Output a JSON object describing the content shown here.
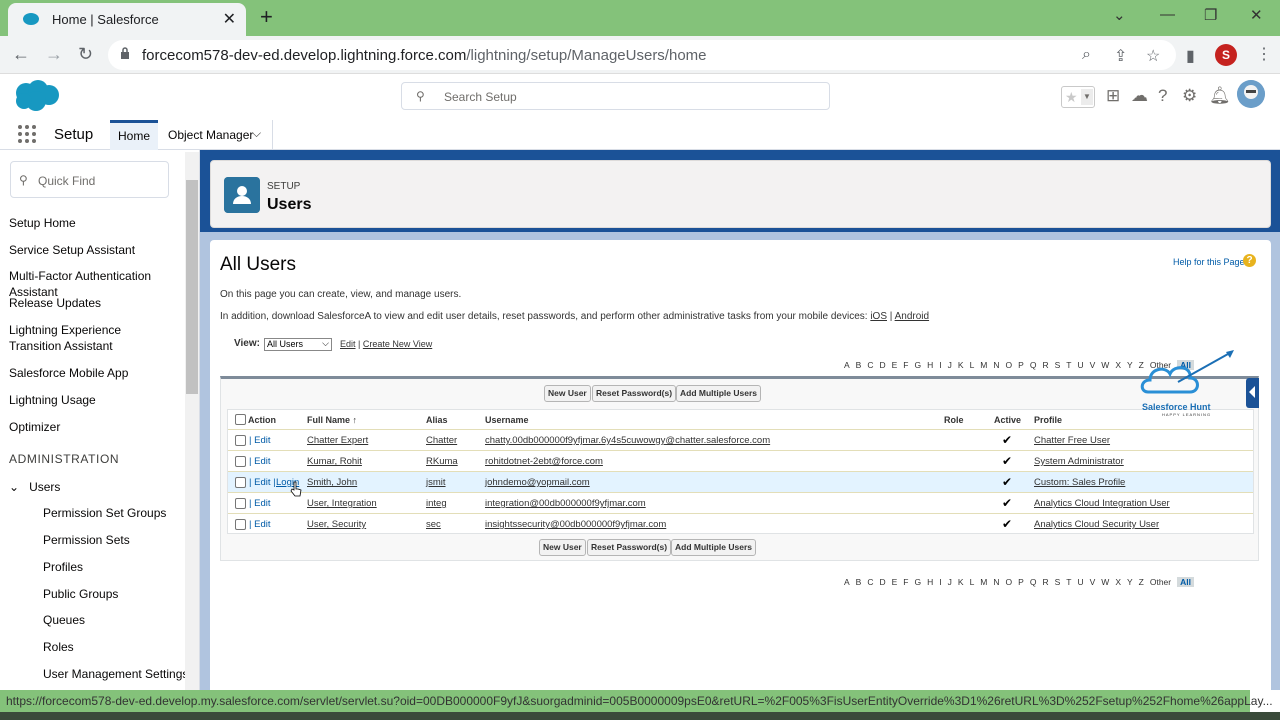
{
  "browser": {
    "tab_title": "Home | Salesforce",
    "url_host": "forcecom578-dev-ed.develop.lightning.force.com",
    "url_path": "/lightning/setup/ManageUsers/home",
    "profile_initial": "S",
    "status_url": "https://forcecom578-dev-ed.develop.my.salesforce.com/servlet/servlet.su?oid=00DB000000F9yfJ&suorgadminid=005B0000009psE0&retURL=%2F005%3FisUserEntityOverride%3D1%26retURL%3D%252Fsetup%252Fhome%26appLay..."
  },
  "header": {
    "search_placeholder": "Search Setup"
  },
  "nav": {
    "app_name": "Setup",
    "tabs": [
      "Home",
      "Object Manager"
    ]
  },
  "sidebar": {
    "quick_find_placeholder": "Quick Find",
    "items": [
      "Setup Home",
      "Service Setup Assistant",
      "Multi-Factor Authentication Assistant",
      "Release Updates",
      "Lightning Experience Transition Assistant",
      "Salesforce Mobile App",
      "Lightning Usage",
      "Optimizer"
    ],
    "section_heading": "ADMINISTRATION",
    "users_label": "Users",
    "sub_items": [
      "Permission Set Groups",
      "Permission Sets",
      "Profiles",
      "Public Groups",
      "Queues",
      "Roles",
      "User Management Settings"
    ]
  },
  "page_header": {
    "eyebrow": "SETUP",
    "title": "Users"
  },
  "content": {
    "heading": "All Users",
    "help_link": "Help for this Page",
    "desc1": "On this page you can create, view, and manage users.",
    "desc2_prefix": "In addition, download SalesforceA to view and edit user details, reset passwords, and perform other administrative tasks from your mobile devices:",
    "ios_link": "iOS",
    "android_link": "Android",
    "view_label": "View:",
    "view_value": "All Users",
    "edit_link": "Edit",
    "create_view_link": "Create New View",
    "alphabet": [
      "A",
      "B",
      "C",
      "D",
      "E",
      "F",
      "G",
      "H",
      "I",
      "J",
      "K",
      "L",
      "M",
      "N",
      "O",
      "P",
      "Q",
      "R",
      "S",
      "T",
      "U",
      "V",
      "W",
      "X",
      "Y",
      "Z",
      "Other",
      "All"
    ],
    "buttons": {
      "new_user": "New User",
      "reset_passwords": "Reset Password(s)",
      "add_multiple": "Add Multiple Users"
    },
    "columns": {
      "action": "Action",
      "full_name": "Full Name",
      "sort_indicator": "↑",
      "alias": "Alias",
      "username": "Username",
      "role": "Role",
      "active": "Active",
      "profile": "Profile"
    },
    "rows": [
      {
        "actions": "| Edit",
        "login": "",
        "full_name": "Chatter Expert",
        "alias": "Chatter",
        "username": "chatty.00db000000f9yfjmar.6y4s5cuwowgy@chatter.salesforce.com",
        "role": "",
        "active": "✔",
        "profile": "Chatter Free User"
      },
      {
        "actions": "| Edit",
        "login": "",
        "full_name": "Kumar, Rohit",
        "alias": "RKuma",
        "username": "rohitdotnet-2ebt@force.com",
        "role": "",
        "active": "✔",
        "profile": "System Administrator"
      },
      {
        "actions": "| Edit |",
        "login": "Login",
        "full_name": "Smith, John",
        "alias": "jsmit",
        "username": "johndemo@yopmail.com",
        "role": "",
        "active": "✔",
        "profile": "Custom: Sales Profile"
      },
      {
        "actions": "| Edit",
        "login": "",
        "full_name": "User, Integration",
        "alias": "integ",
        "username": "integration@00db000000f9yfjmar.com",
        "role": "",
        "active": "✔",
        "profile": "Analytics Cloud Integration User"
      },
      {
        "actions": "| Edit",
        "login": "",
        "full_name": "User, Security",
        "alias": "sec",
        "username": "insightssecurity@00db000000f9yfjmar.com",
        "role": "",
        "active": "✔",
        "profile": "Analytics Cloud Security User"
      }
    ]
  },
  "watermark": {
    "name": "Salesforce Hunt",
    "tagline": "HAPPY LEARNING"
  },
  "colors": {
    "brand_blue": "#1b5297",
    "link_blue": "#015ba7",
    "chrome_green": "#84c27a"
  }
}
